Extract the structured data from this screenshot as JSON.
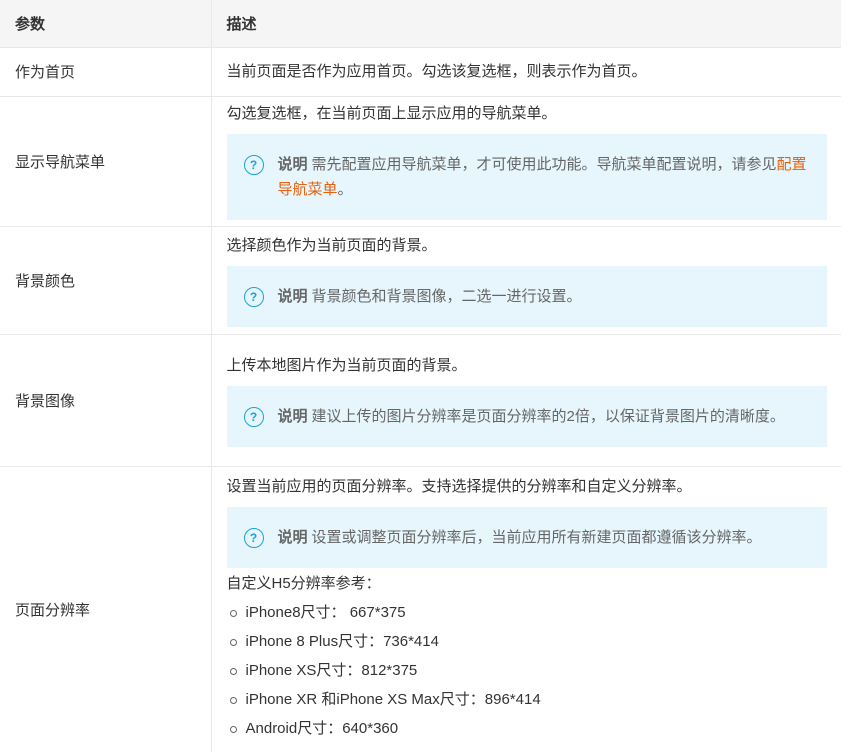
{
  "header": {
    "col1": "参数",
    "col2": "描述"
  },
  "rows": {
    "home": {
      "param": "作为首页",
      "desc": "当前页面是否作为应用首页。勾选该复选框，则表示作为首页。"
    },
    "nav": {
      "param": "显示导航菜单",
      "desc": "勾选复选框，在当前页面上显示应用的导航菜单。",
      "note_label": "说明",
      "note_text": "需先配置应用导航菜单，才可使用此功能。导航菜单配置说明，请参见",
      "note_link": "配置导航菜单",
      "note_end": "。"
    },
    "bgcolor": {
      "param": "背景颜色",
      "desc": "选择颜色作为当前页面的背景。",
      "note_label": "说明",
      "note_text": "背景颜色和背景图像，二选一进行设置。"
    },
    "bgimage": {
      "param": "背景图像",
      "desc": "上传本地图片作为当前页面的背景。",
      "note_label": "说明",
      "note_text": "建议上传的图片分辨率是页面分辨率的2倍，以保证背景图片的清晰度。"
    },
    "resolution": {
      "param": "页面分辨率",
      "desc": "设置当前应用的页面分辨率。支持选择提供的分辨率和自定义分辨率。",
      "note_label": "说明",
      "note_text": "设置或调整页面分辨率后，当前应用所有新建页面都遵循该分辨率。",
      "list_title": "自定义H5分辨率参考：",
      "items": [
        "iPhone8尺寸： 667*375",
        "iPhone 8 Plus尺寸：736*414",
        "iPhone XS尺寸：812*375",
        "iPhone XR 和iPhone XS Max尺寸：896*414",
        "Android尺寸：640*360"
      ]
    }
  },
  "colors": {
    "accent": "#1ba3d8",
    "link": "#e8610f",
    "note_bg": "#e6f6fc",
    "header_bg": "#f5f5f5"
  },
  "icons": {
    "note": "question-circle-icon"
  }
}
